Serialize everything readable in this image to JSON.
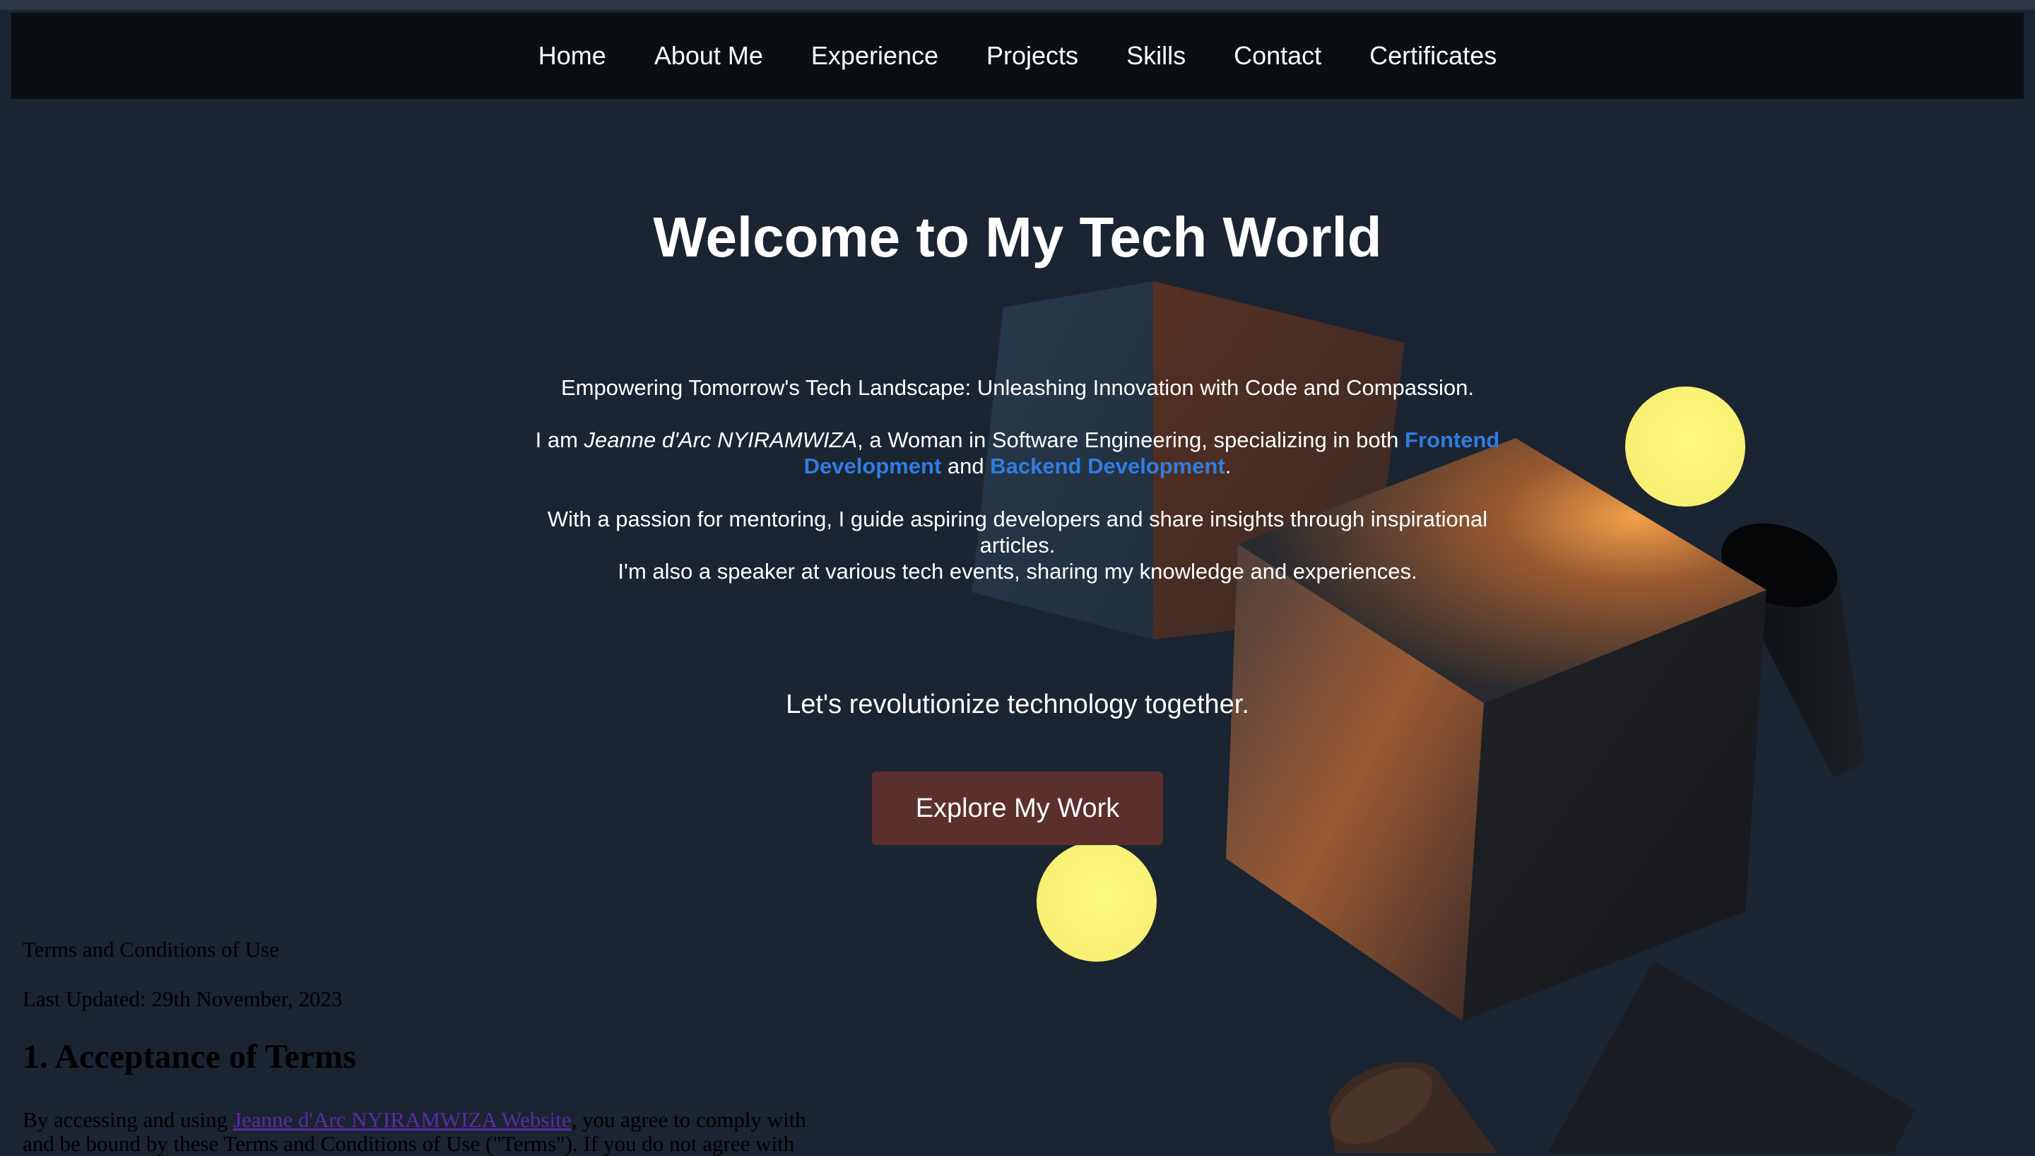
{
  "nav": {
    "items": [
      {
        "label": "Home"
      },
      {
        "label": "About Me"
      },
      {
        "label": "Experience"
      },
      {
        "label": "Projects"
      },
      {
        "label": "Skills"
      },
      {
        "label": "Contact"
      },
      {
        "label": "Certificates"
      }
    ]
  },
  "hero": {
    "title": "Welcome to My Tech World",
    "subtitle": "Empowering Tomorrow's Tech Landscape: Unleashing Innovation with Code and Compassion.",
    "intro_prefix": "I am ",
    "name": "Jeanne d'Arc NYIRAMWIZA",
    "intro_middle": ", a Woman in Software Engineering, specializing in both ",
    "frontend": "Frontend Development",
    "and_text": " and ",
    "backend": "Backend Development",
    "period": ".",
    "mentoring": "With a passion for mentoring, I guide aspiring developers and share insights through inspirational articles.",
    "speaker": "I'm also a speaker at various tech events, sharing my knowledge and experiences.",
    "tagline": "Let's revolutionize technology together.",
    "cta_label": "Explore My Work"
  },
  "terms": {
    "heading": "Terms and Conditions of Use",
    "updated": "Last Updated: 29th November, 2023",
    "section1_title": "1. Acceptance of Terms",
    "section1_prefix": "By accessing and using ",
    "section1_link": "Jeanne d'Arc NYIRAMWIZA Website",
    "section1_suffix": ", you agree to comply with and be bound by these Terms and Conditions of Use (\"Terms\"). If you do not agree with"
  },
  "colors": {
    "background": "#1b2431",
    "nav_background": "#0b0f13",
    "accent_link": "#2f7de1",
    "cta_background": "#5a2f2c",
    "sphere": "#fbf57a"
  }
}
